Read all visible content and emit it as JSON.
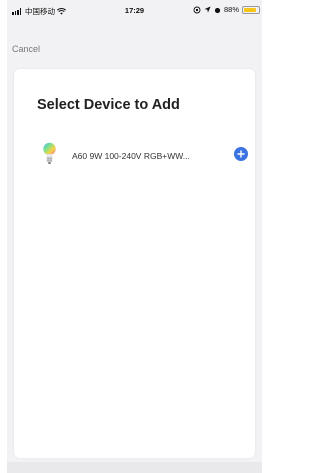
{
  "status_bar": {
    "carrier": "中国移动",
    "time": "17:29",
    "battery": "88%",
    "battery_level": 0.88,
    "battery_color": "#f5c518"
  },
  "nav": {
    "cancel_label": "Cancel"
  },
  "card": {
    "title": "Select Device to Add",
    "devices": [
      {
        "name": "A60 9W 100-240V RGB+WW...",
        "icon": "rgb-bulb-icon",
        "action_icon": "plus-icon"
      }
    ]
  },
  "colors": {
    "accent": "#3b73e3",
    "background": "#f2f2f4",
    "card": "#ffffff"
  }
}
